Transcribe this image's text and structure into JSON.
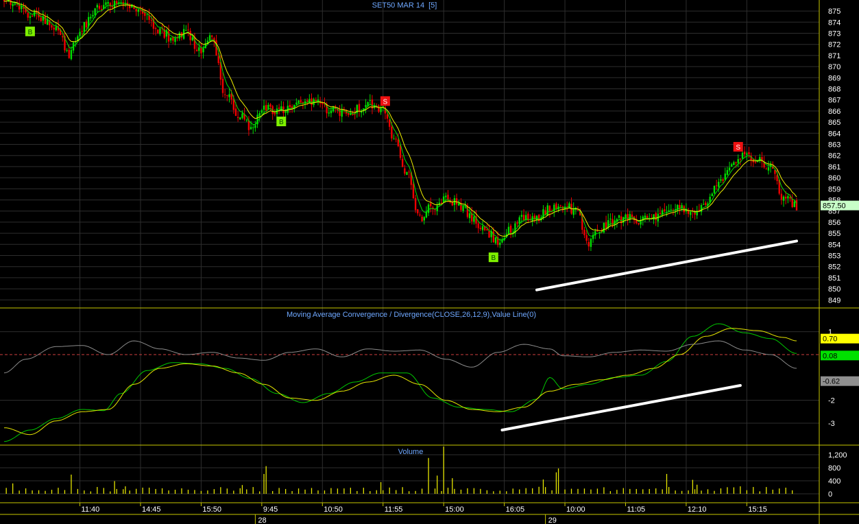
{
  "chart_data": [
    {
      "type": "candlestick",
      "title": "SET50 MAR 14",
      "period_label": "[5]",
      "ylim": [
        848,
        876
      ],
      "y_ticks": [
        849,
        850,
        851,
        852,
        853,
        854,
        855,
        856,
        857,
        858,
        859,
        860,
        861,
        862,
        863,
        864,
        865,
        866,
        867,
        868,
        869,
        870,
        871,
        872,
        873,
        874,
        875
      ],
      "last_price": "857.50",
      "series": [
        {
          "kind": "ohlc",
          "anchors": [
            [
              0,
              876.2
            ],
            [
              6,
              875.5
            ],
            [
              12,
              874.8
            ],
            [
              18,
              874.2
            ],
            [
              24,
              873.5
            ],
            [
              30,
              871.2
            ],
            [
              36,
              873.5
            ],
            [
              42,
              875.2
            ],
            [
              48,
              875.6
            ],
            [
              54,
              875.5
            ],
            [
              60,
              875.2
            ],
            [
              66,
              874.3
            ],
            [
              72,
              873.2
            ],
            [
              78,
              872.5
            ],
            [
              84,
              873.2
            ],
            [
              90,
              871.5
            ],
            [
              96,
              872.6
            ],
            [
              102,
              867.5
            ],
            [
              108,
              865.8
            ],
            [
              114,
              864.5
            ],
            [
              120,
              866.2
            ],
            [
              126,
              866.0
            ],
            [
              132,
              866.2
            ],
            [
              138,
              866.6
            ],
            [
              144,
              866.8
            ],
            [
              150,
              866.2
            ],
            [
              156,
              866.0
            ],
            [
              162,
              866.1
            ],
            [
              168,
              866.7
            ],
            [
              174,
              866.2
            ],
            [
              180,
              863.8
            ],
            [
              186,
              860.6
            ],
            [
              192,
              856.4
            ],
            [
              198,
              857.4
            ],
            [
              204,
              858.1
            ],
            [
              210,
              857.6
            ],
            [
              216,
              856.3
            ],
            [
              222,
              855.2
            ],
            [
              228,
              854.3
            ],
            [
              234,
              855.2
            ],
            [
              240,
              856.3
            ],
            [
              246,
              856.4
            ],
            [
              252,
              857.2
            ],
            [
              258,
              857.6
            ],
            [
              264,
              857.0
            ],
            [
              270,
              854.2
            ],
            [
              276,
              855.5
            ],
            [
              282,
              856.1
            ],
            [
              288,
              856.6
            ],
            [
              294,
              856.2
            ],
            [
              300,
              856.3
            ],
            [
              306,
              856.8
            ],
            [
              312,
              857.3
            ],
            [
              318,
              857.0
            ],
            [
              324,
              857.4
            ],
            [
              330,
              859.8
            ],
            [
              336,
              861.2
            ],
            [
              342,
              862.2
            ],
            [
              348,
              861.6
            ],
            [
              354,
              860.8
            ],
            [
              360,
              858.1
            ],
            [
              366,
              857.5
            ]
          ]
        },
        {
          "kind": "ema_fast",
          "color": "#00e000"
        },
        {
          "kind": "ema_slow",
          "color": "#f0f000"
        }
      ],
      "signals": [
        {
          "label": "B",
          "i": 12,
          "color": "#7ff000"
        },
        {
          "label": "B",
          "i": 128,
          "color": "#7ff000"
        },
        {
          "label": "S",
          "i": 176,
          "color": "#ee1111"
        },
        {
          "label": "B",
          "i": 226,
          "color": "#7ff000"
        },
        {
          "label": "S",
          "i": 339,
          "color": "#ee1111"
        }
      ],
      "trendline": {
        "from": [
          246,
          849.9
        ],
        "to": [
          366,
          854.3
        ]
      }
    },
    {
      "type": "line",
      "title": "Moving Average Convergence / Divergence(CLOSE,26,12,9),Value Line(0)",
      "ylim": [
        -3.8,
        1.9
      ],
      "y_ticks": [
        1,
        -2,
        -3
      ],
      "value_line": 0,
      "last_values": [
        "0.70",
        "0.08",
        "-0.62"
      ],
      "series": [
        {
          "name": "MACD",
          "color": "#00c800",
          "anchors": [
            [
              0,
              -3.8
            ],
            [
              12,
              -3.3
            ],
            [
              24,
              -2.8
            ],
            [
              36,
              -2.4
            ],
            [
              46,
              -2.45
            ],
            [
              54,
              -1.7
            ],
            [
              66,
              -0.7
            ],
            [
              78,
              -0.35
            ],
            [
              90,
              -0.4
            ],
            [
              102,
              -0.6
            ],
            [
              114,
              -1.05
            ],
            [
              126,
              -1.7
            ],
            [
              138,
              -2.1
            ],
            [
              150,
              -1.7
            ],
            [
              162,
              -1.2
            ],
            [
              174,
              -0.8
            ],
            [
              186,
              -0.8
            ],
            [
              198,
              -1.9
            ],
            [
              210,
              -2.3
            ],
            [
              222,
              -2.4
            ],
            [
              234,
              -2.5
            ],
            [
              246,
              -1.95
            ],
            [
              252,
              -1.0
            ],
            [
              258,
              -1.5
            ],
            [
              270,
              -1.3
            ],
            [
              282,
              -1.0
            ],
            [
              294,
              -0.9
            ],
            [
              306,
              -0.3
            ],
            [
              318,
              0.8
            ],
            [
              330,
              1.35
            ],
            [
              342,
              0.95
            ],
            [
              354,
              0.7
            ],
            [
              366,
              0.05
            ]
          ]
        },
        {
          "name": "Signal",
          "color": "#e6e600",
          "anchors": [
            [
              0,
              -3.2
            ],
            [
              12,
              -3.5
            ],
            [
              24,
              -2.9
            ],
            [
              36,
              -2.5
            ],
            [
              48,
              -2.4
            ],
            [
              60,
              -1.3
            ],
            [
              72,
              -0.6
            ],
            [
              84,
              -0.4
            ],
            [
              96,
              -0.5
            ],
            [
              108,
              -0.8
            ],
            [
              120,
              -1.3
            ],
            [
              132,
              -1.9
            ],
            [
              144,
              -2.0
            ],
            [
              156,
              -1.6
            ],
            [
              168,
              -1.2
            ],
            [
              180,
              -0.9
            ],
            [
              192,
              -1.3
            ],
            [
              204,
              -2.0
            ],
            [
              216,
              -2.4
            ],
            [
              228,
              -2.5
            ],
            [
              240,
              -2.3
            ],
            [
              252,
              -1.6
            ],
            [
              264,
              -1.3
            ],
            [
              276,
              -1.1
            ],
            [
              288,
              -0.9
            ],
            [
              300,
              -0.6
            ],
            [
              312,
              0.0
            ],
            [
              324,
              0.8
            ],
            [
              336,
              1.15
            ],
            [
              348,
              1.05
            ],
            [
              360,
              0.75
            ],
            [
              366,
              0.6
            ]
          ]
        },
        {
          "name": "Histogram",
          "color": "#8c8c8c",
          "anchors": [
            [
              0,
              -0.8
            ],
            [
              10,
              -0.2
            ],
            [
              24,
              0.35
            ],
            [
              36,
              0.4
            ],
            [
              48,
              0.0
            ],
            [
              60,
              0.6
            ],
            [
              72,
              0.25
            ],
            [
              84,
              0.0
            ],
            [
              96,
              0.1
            ],
            [
              108,
              -0.15
            ],
            [
              120,
              -0.25
            ],
            [
              132,
              0.1
            ],
            [
              144,
              0.25
            ],
            [
              156,
              -0.1
            ],
            [
              168,
              0.25
            ],
            [
              180,
              0.15
            ],
            [
              192,
              0.2
            ],
            [
              204,
              -0.2
            ],
            [
              216,
              -0.55
            ],
            [
              228,
              0.1
            ],
            [
              240,
              0.45
            ],
            [
              252,
              0.25
            ],
            [
              258,
              -0.05
            ],
            [
              270,
              -0.1
            ],
            [
              282,
              0.1
            ],
            [
              294,
              0.2
            ],
            [
              306,
              0.15
            ],
            [
              318,
              0.45
            ],
            [
              330,
              0.6
            ],
            [
              342,
              0.2
            ],
            [
              354,
              0.0
            ],
            [
              366,
              -0.6
            ]
          ]
        }
      ],
      "trendline": {
        "from": [
          230,
          -3.3
        ],
        "to": [
          340,
          -1.35
        ]
      }
    },
    {
      "type": "bar",
      "title": "Volume",
      "ylim": [
        0,
        1600
      ],
      "y_ticks": [
        0,
        400,
        800,
        1200
      ],
      "y_tick_labels": [
        "0",
        "400",
        "800",
        "1,200"
      ],
      "base": 160,
      "spikes": [
        [
          4,
          320
        ],
        [
          31,
          590
        ],
        [
          51,
          390
        ],
        [
          56,
          230
        ],
        [
          110,
          270
        ],
        [
          120,
          610
        ],
        [
          121,
          850
        ],
        [
          174,
          360
        ],
        [
          196,
          1100
        ],
        [
          200,
          560
        ],
        [
          203,
          1450
        ],
        [
          207,
          480
        ],
        [
          214,
          170
        ],
        [
          249,
          440
        ],
        [
          255,
          660
        ],
        [
          256,
          780
        ],
        [
          306,
          610
        ],
        [
          318,
          430
        ],
        [
          320,
          280
        ],
        [
          340,
          230
        ],
        [
          346,
          210
        ]
      ],
      "x_tick_labels": [
        "11:40",
        "14:45",
        "15:50",
        "9:45",
        "10:50",
        "11:55",
        "15:00",
        "16:05",
        "10:00",
        "11:05",
        "12:10",
        "15:15"
      ],
      "x_tick_i": [
        35,
        63,
        91,
        119,
        147,
        175,
        203,
        231,
        259,
        287,
        315,
        343
      ],
      "day_labels": [
        "28",
        "29"
      ],
      "day_i": [
        116,
        250
      ],
      "n_points": 367
    }
  ]
}
